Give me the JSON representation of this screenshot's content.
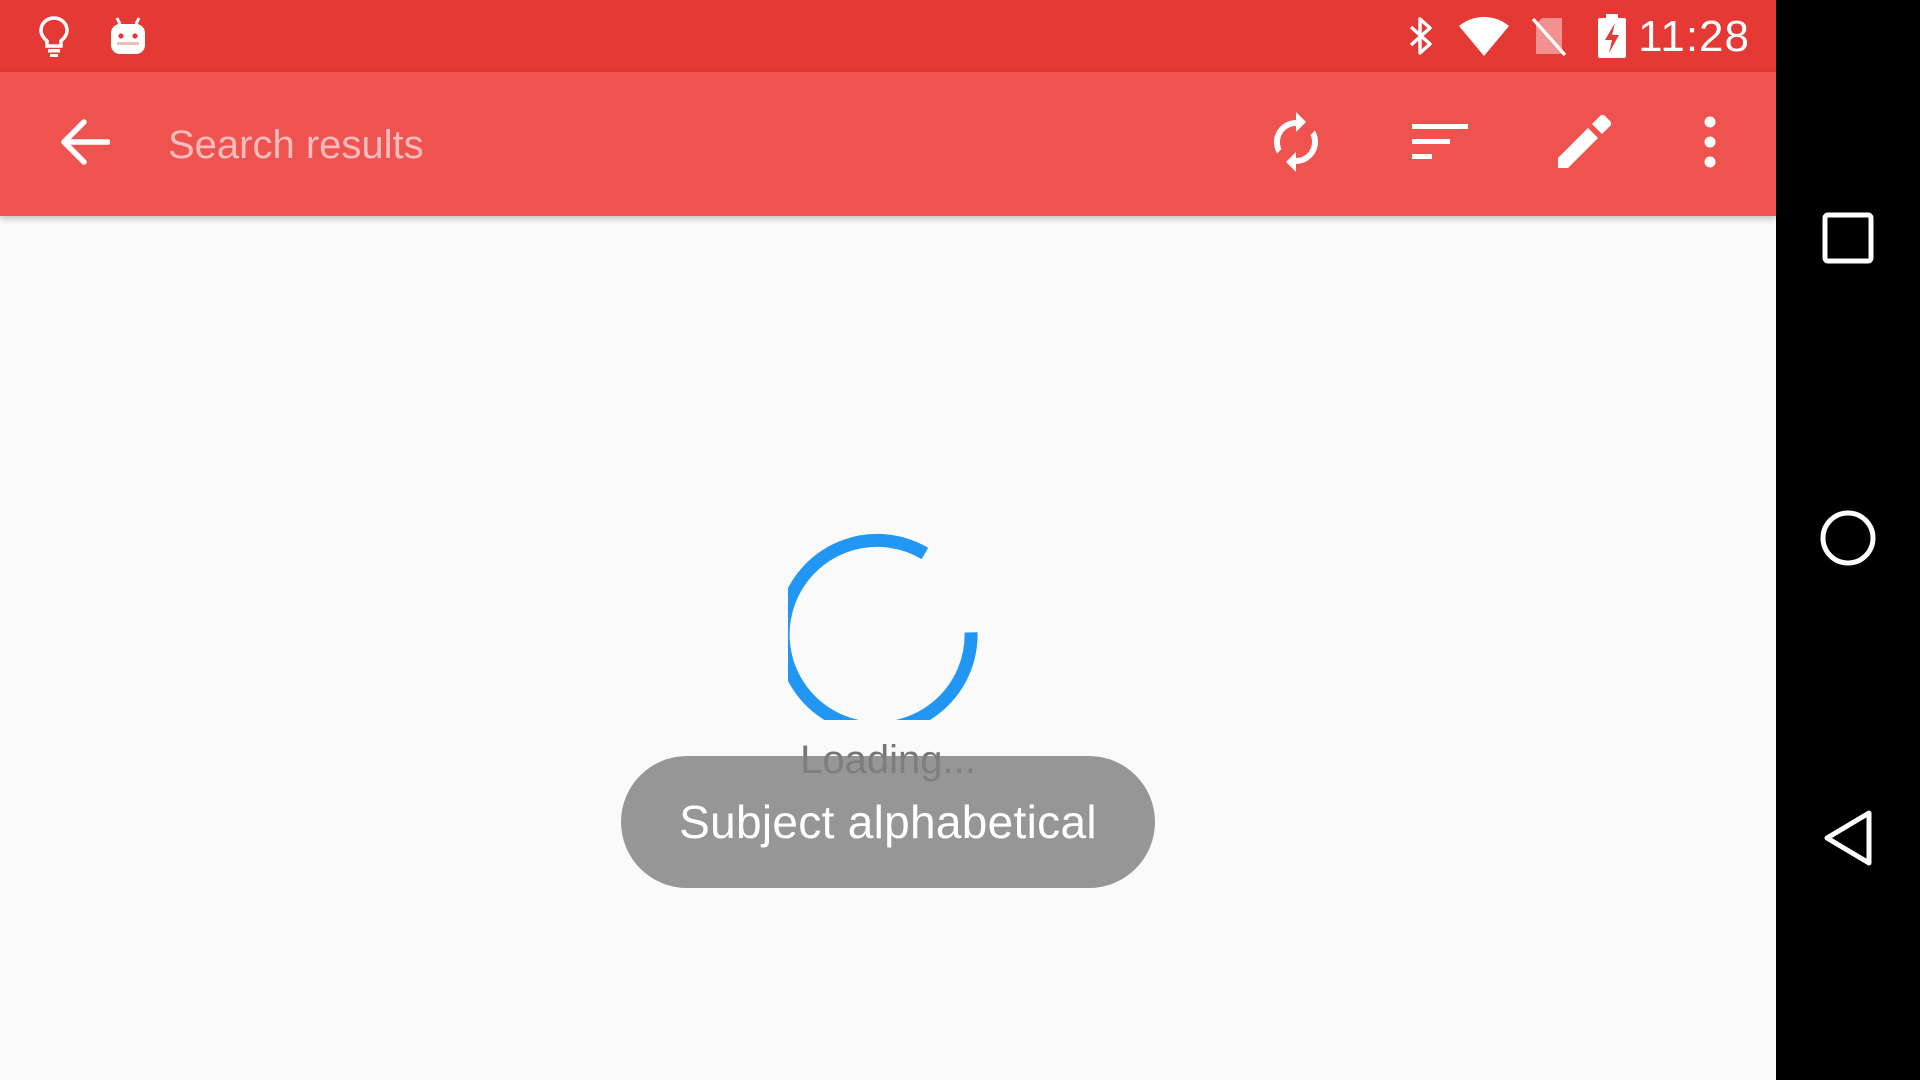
{
  "status_bar": {
    "time": "11:28",
    "color": "#e53935",
    "left_icons": [
      "lightbulb-icon",
      "android-icon"
    ],
    "right_icons": [
      "bluetooth-icon",
      "wifi-icon",
      "no-sim-icon",
      "battery-charging-icon"
    ]
  },
  "toolbar": {
    "title": "Search results",
    "color": "#ef5350",
    "actions": [
      "back-arrow-icon",
      "sync-icon",
      "sort-icon",
      "edit-pencil-icon",
      "more-vert-icon"
    ]
  },
  "loading": {
    "text": "Loading...",
    "spinner_color": "#2196f3"
  },
  "toast": {
    "text": "Subject alphabetical"
  },
  "nav_bar": {
    "buttons": [
      "recents-square-icon",
      "home-circle-icon",
      "back-triangle-icon"
    ]
  }
}
